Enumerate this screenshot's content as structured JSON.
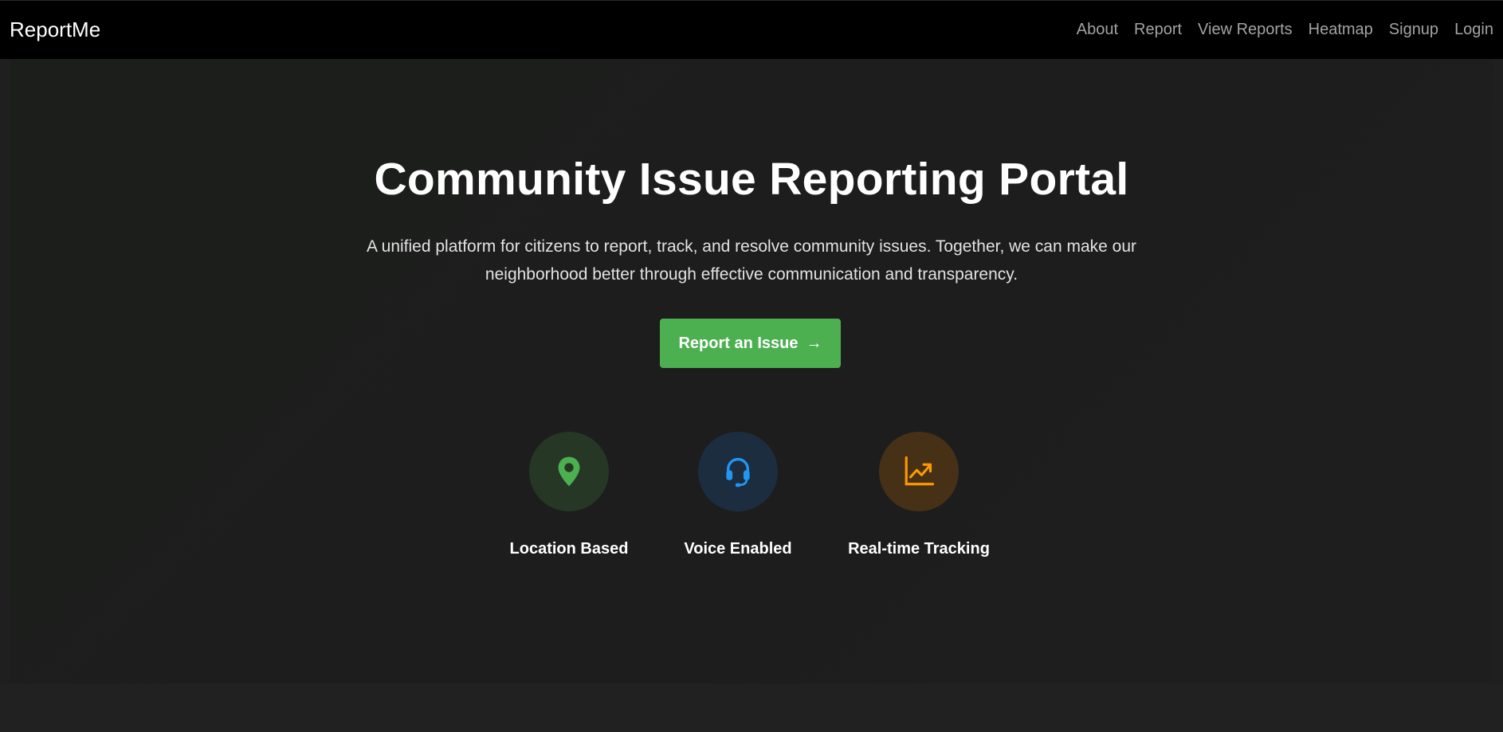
{
  "navbar": {
    "brand": "ReportMe",
    "links": [
      "About",
      "Report",
      "View Reports",
      "Heatmap",
      "Signup",
      "Login"
    ]
  },
  "hero": {
    "title": "Community Issue Reporting Portal",
    "subtitle": "A unified platform for citizens to report, track, and resolve community issues. Together, we can make our neighborhood better through effective communication and transparency.",
    "cta_label": "Report an Issue",
    "cta_arrow": "→"
  },
  "features": [
    {
      "label": "Location Based",
      "icon": "map-pin-icon",
      "color": "#4caf50",
      "bg": "#263726"
    },
    {
      "label": "Voice Enabled",
      "icon": "headset-icon",
      "color": "#2196f3",
      "bg": "#1c2d40"
    },
    {
      "label": "Real-time Tracking",
      "icon": "trending-chart-icon",
      "color": "#ff9800",
      "bg": "#463117"
    }
  ],
  "colors": {
    "navbar_bg": "#000000",
    "page_bg": "#1f1f1f",
    "accent_green": "#4caf50"
  }
}
